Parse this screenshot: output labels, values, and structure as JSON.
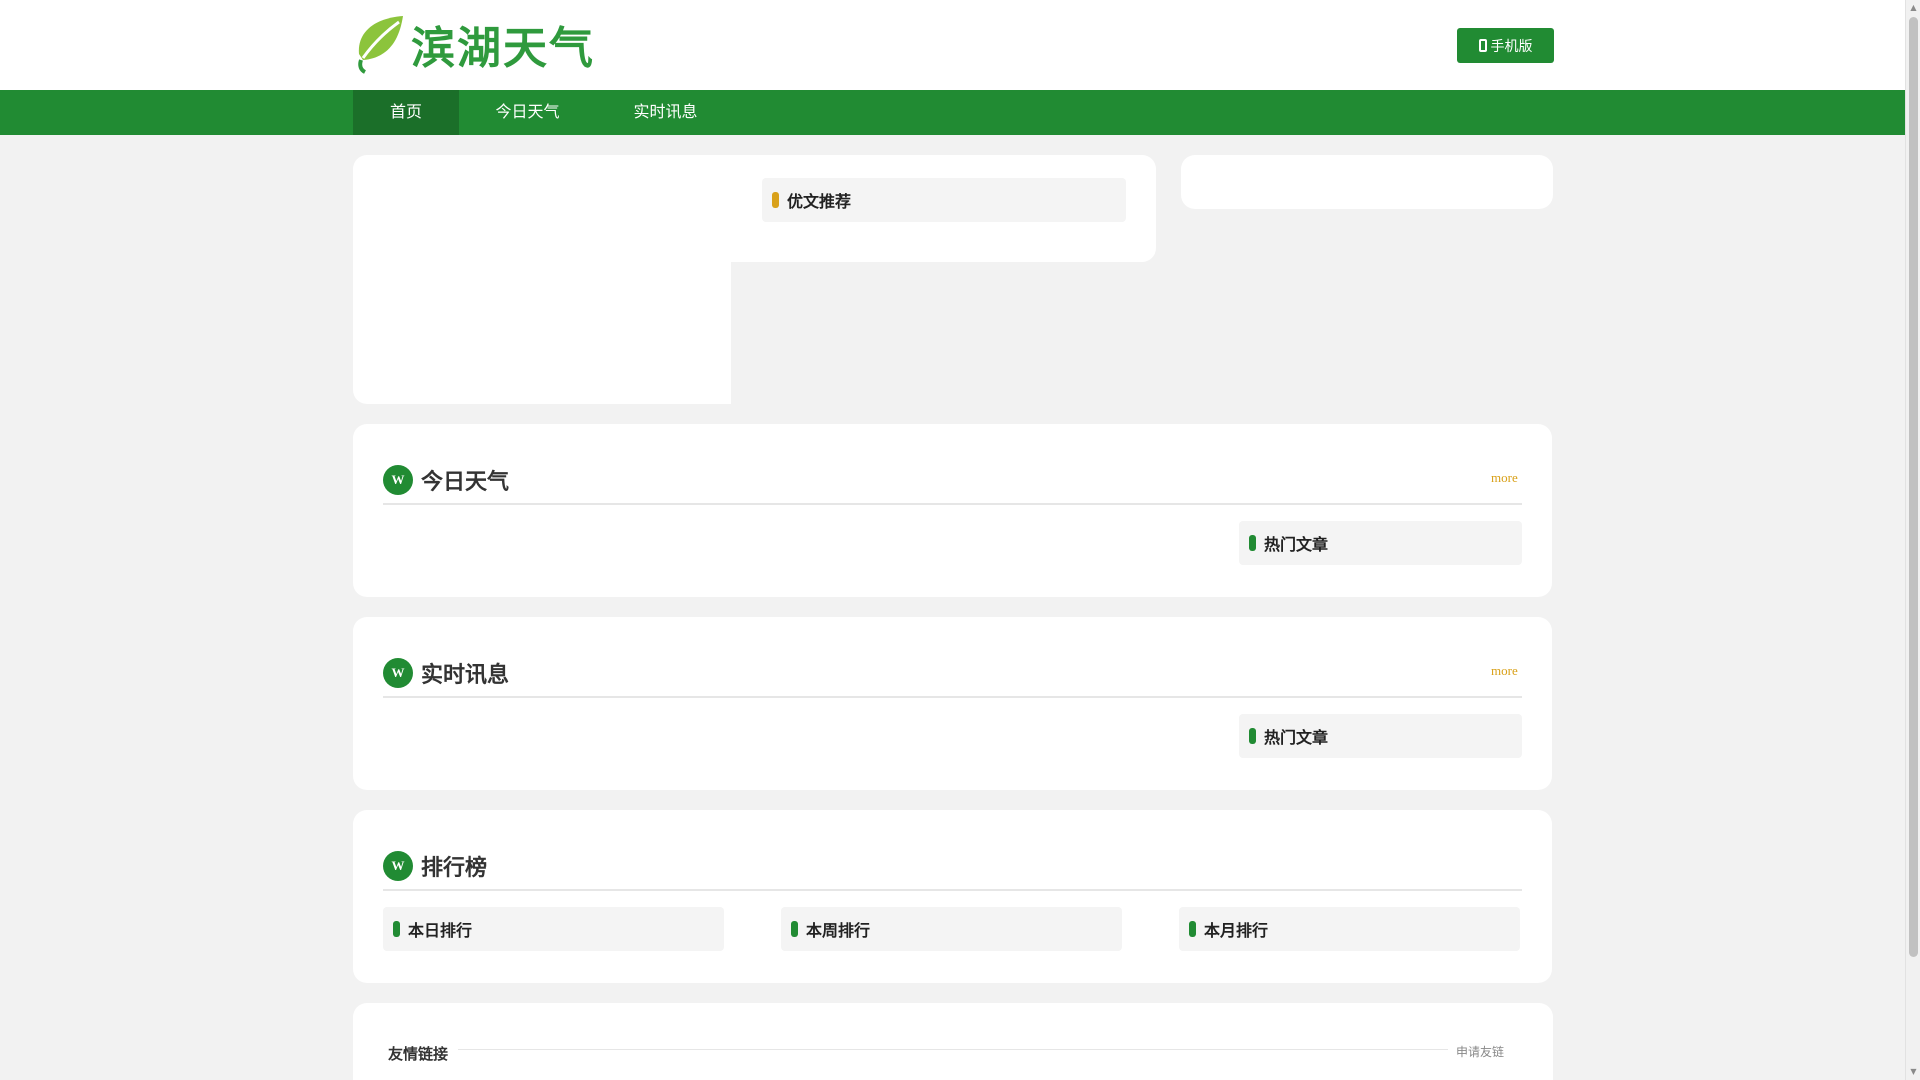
{
  "header": {
    "logo_text": "滨湖天气",
    "mobile_label": "手机版",
    "colors": {
      "brand": "#218b33",
      "nav_active": "#1b6f29",
      "accent": "#d9a11a"
    }
  },
  "nav": {
    "items": [
      {
        "label": "首页",
        "active": true
      },
      {
        "label": "今日天气",
        "active": false
      },
      {
        "label": "实时讯息",
        "active": false
      }
    ]
  },
  "featured": {
    "recommend_title": "优文推荐"
  },
  "sections": [
    {
      "badge": "W",
      "title": "今日天气",
      "more": "more",
      "side_title": "热门文章"
    },
    {
      "badge": "W",
      "title": "实时讯息",
      "more": "more",
      "side_title": "热门文章"
    }
  ],
  "ranking": {
    "badge": "W",
    "title": "排行榜",
    "columns": [
      "本日排行",
      "本周排行",
      "本月排行"
    ]
  },
  "friends": {
    "title": "友情链接",
    "apply": "申请友链"
  }
}
